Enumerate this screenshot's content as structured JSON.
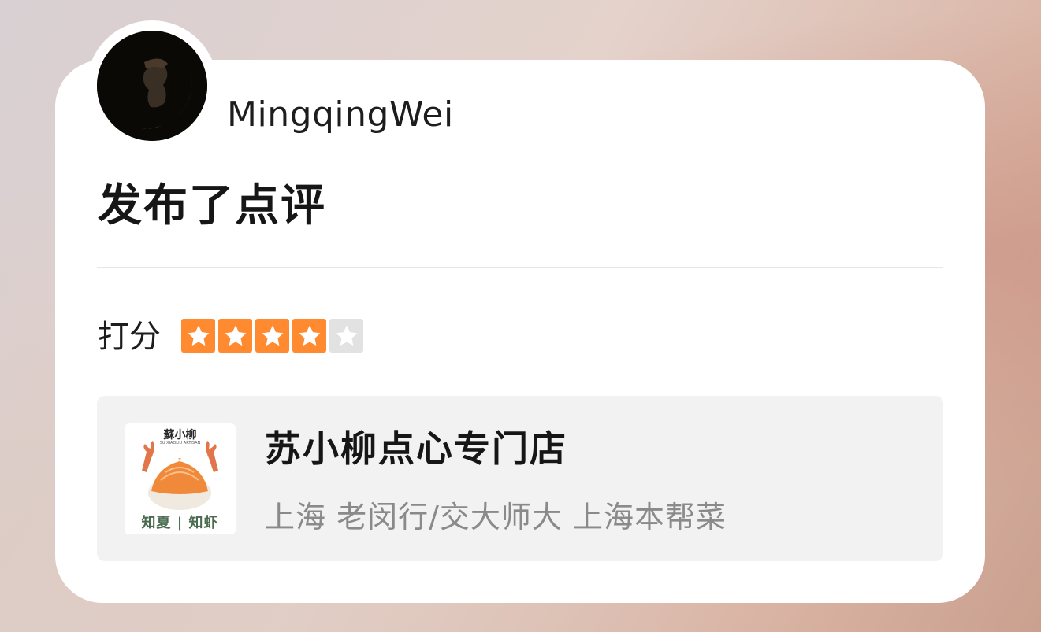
{
  "post": {
    "username": "MingqingWei",
    "action_title": "发布了点评"
  },
  "rating": {
    "label": "打分",
    "value": 4,
    "max": 5,
    "star_on_color": "#ff8a30",
    "star_off_color": "#e2e2e2"
  },
  "shop": {
    "name": "苏小柳点心专门店",
    "meta": "上海 老闵行/交大师大 上海本帮菜",
    "logo_title": "蘇小柳",
    "logo_subtitle": "SU XIAOLIU ARTISAN",
    "logo_bottom": "知夏 | 知虾"
  },
  "icons": {
    "avatar": "crescent-moon-avatar",
    "star": "star-icon"
  }
}
